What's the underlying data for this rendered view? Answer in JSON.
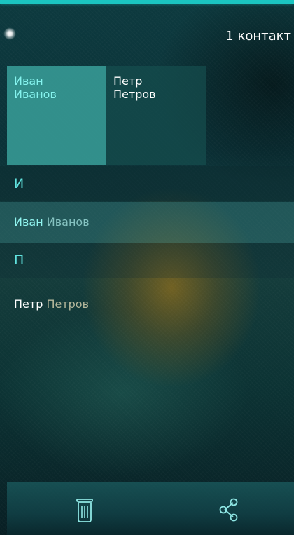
{
  "header": {
    "contact_count": "1 контакт"
  },
  "favorites": [
    {
      "first": "Иван",
      "last": "Иванов",
      "selected": true
    },
    {
      "first": "Петр",
      "last": "Петров",
      "selected": false
    }
  ],
  "sections": [
    {
      "letter": "И",
      "contacts": [
        {
          "first": "Иван",
          "last": "Иванов",
          "selected": true
        }
      ]
    },
    {
      "letter": "П",
      "contacts": [
        {
          "first": "Петр",
          "last": "Петров",
          "selected": false
        }
      ]
    }
  ],
  "bottom_bar": {
    "actions": [
      {
        "icon": "trash-icon"
      },
      {
        "icon": "share-icon"
      }
    ]
  },
  "colors": {
    "accent": "#1bc5c1",
    "selected_text": "#85f3ee",
    "section_letter": "#61e3df"
  }
}
